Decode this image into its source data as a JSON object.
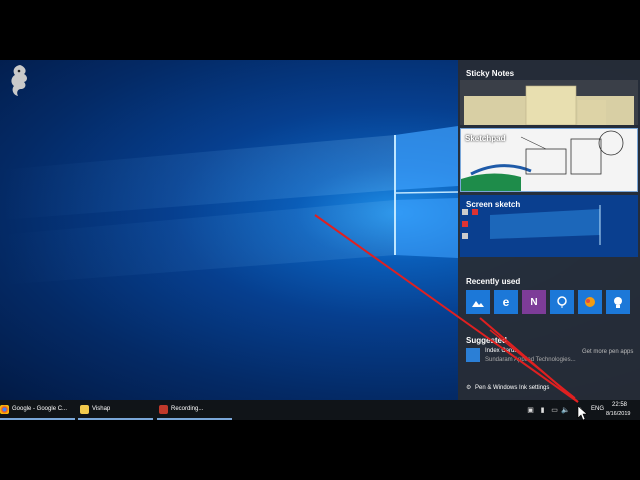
{
  "ink_workspace": {
    "sticky_notes": "Sticky Notes",
    "sketchpad": "Sketchpad",
    "screen_sketch": "Screen sketch",
    "recently_used": "Recently used",
    "recent_apps": [
      "photos-icon",
      "edge-icon",
      "onenote-icon",
      "maps-icon",
      "paint3d-icon",
      "tips-icon"
    ],
    "suggested": "Suggested",
    "suggested_app_name": "Index Cards",
    "suggested_app_publisher": "Sundaram Applied Technologies...",
    "get_more_apps": "Get more pen apps",
    "settings_link": "Pen & Windows Ink settings"
  },
  "taskbar": {
    "apps": [
      {
        "label": "Google - Google C...",
        "icon": "chrome-icon"
      },
      {
        "label": "Vishap",
        "icon": "folder-icon"
      },
      {
        "label": "Recording...",
        "icon": "recorder-icon"
      }
    ],
    "language": "ENG",
    "time": "22:58",
    "date": "8/16/2019"
  },
  "colors": {
    "accent": "#1c78d8",
    "annotation": "#e02020"
  }
}
